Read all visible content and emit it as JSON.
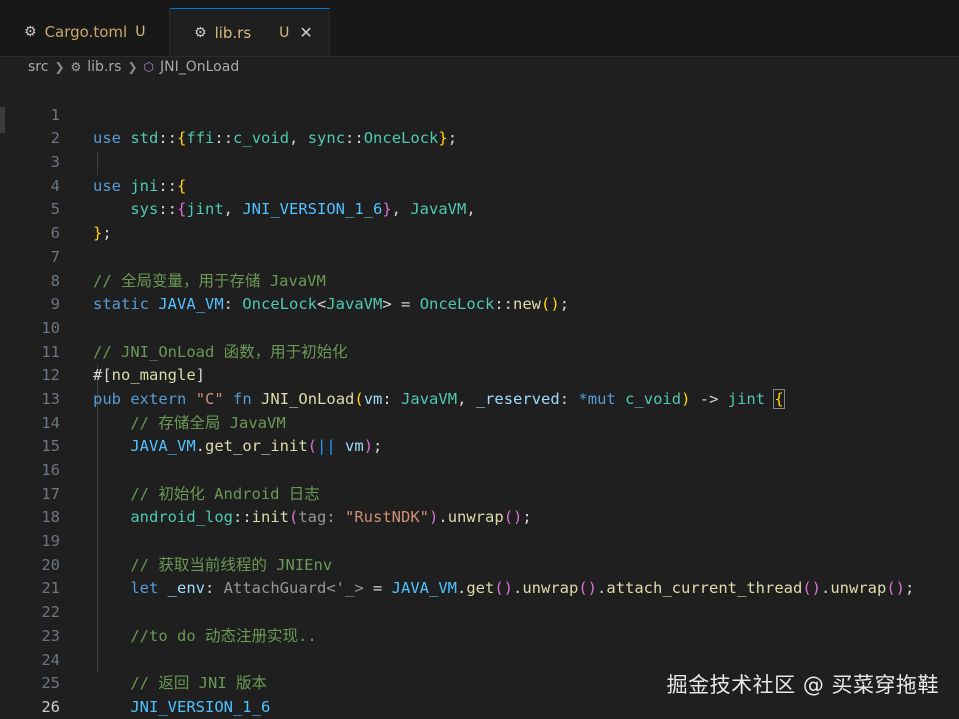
{
  "tabs": [
    {
      "label": "Cargo.toml",
      "badge": "U",
      "icon": "gear-icon",
      "active": false
    },
    {
      "label": "lib.rs",
      "badge": "U",
      "icon": "rust-icon",
      "active": true,
      "close": "✕"
    }
  ],
  "breadcrumb": {
    "folder": "src",
    "file": "lib.rs",
    "symbol": "JNI_OnLoad"
  },
  "line_numbers": [
    "1",
    "2",
    "3",
    "4",
    "5",
    "6",
    "7",
    "8",
    "9",
    "10",
    "11",
    "12",
    "13",
    "14",
    "15",
    "16",
    "17",
    "18",
    "19",
    "20",
    "21",
    "22",
    "23",
    "24",
    "25",
    "26"
  ],
  "code": {
    "l1": [
      "use",
      "std",
      "::",
      "{",
      "ffi",
      "::",
      "c_void",
      ", ",
      "sync",
      "::",
      "OnceLock",
      "}",
      ";"
    ],
    "l3": [
      "use",
      "jni",
      "::",
      "{"
    ],
    "l4": [
      "sys",
      "::",
      "{",
      "jint",
      ", ",
      "JNI_VERSION_1_6",
      "}",
      ", ",
      "JavaVM",
      ","
    ],
    "l5": [
      "}",
      ";"
    ],
    "l7": "// 全局变量，用于存储 JavaVM",
    "l8": [
      "static",
      "JAVA_VM",
      ": ",
      "OnceLock",
      "<",
      "JavaVM",
      ">",
      " = ",
      "OnceLock",
      "::",
      "new",
      "()",
      ";"
    ],
    "l10": "// JNI_OnLoad 函数，用于初始化",
    "l11": [
      "#[",
      "no_mangle",
      "]"
    ],
    "l12": [
      "pub",
      "extern",
      "\"C\"",
      "fn",
      "JNI_OnLoad",
      "(",
      "vm",
      ": ",
      "JavaVM",
      ", ",
      "_reserved",
      ": ",
      "*mut",
      "c_void",
      ")",
      " -> ",
      "jint",
      "{"
    ],
    "l13": "// 存储全局 JavaVM",
    "l14": [
      "JAVA_VM",
      ".",
      "get_or_init",
      "(",
      "||",
      "vm",
      ")",
      ";"
    ],
    "l16": "// 初始化 Android 日志",
    "l17": [
      "android_log",
      "::",
      "init",
      "(",
      "tag:",
      "\"RustNDK\"",
      ")",
      ".",
      "unwrap",
      "()",
      ";"
    ],
    "l19": "// 获取当前线程的 JNIEnv",
    "l20": [
      "let",
      "_env",
      ": ",
      "AttachGuard<'_>",
      " = ",
      "JAVA_VM",
      ".",
      "get",
      "()",
      ".",
      "unwrap",
      "()",
      ".",
      "attach_current_thread",
      "()",
      ".",
      "unwrap",
      "()",
      ";"
    ],
    "l22": "//to do 动态注册实现..",
    "l24": "// 返回 JNI 版本",
    "l25": "JNI_VERSION_1_6",
    "l26": "}"
  },
  "watermark": "掘金技术社区 @ 买菜穿拖鞋"
}
